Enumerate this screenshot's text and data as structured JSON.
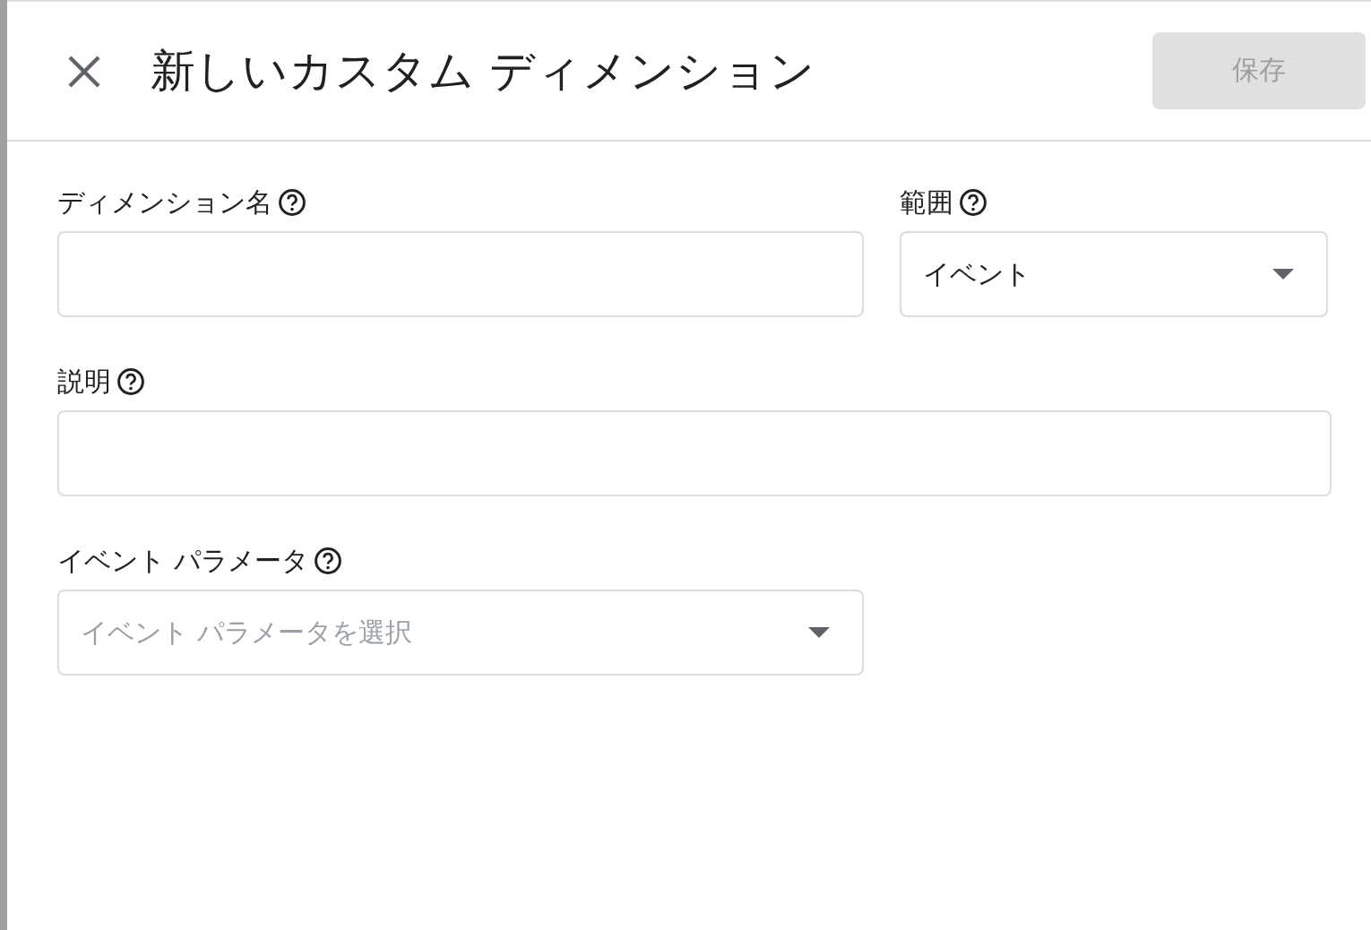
{
  "header": {
    "title": "新しいカスタム ディメンション",
    "save_button": {
      "label": "保存",
      "disabled": true
    }
  },
  "rows": [
    [
      {
        "kind": "text",
        "label": "ディメンション名"
      },
      {
        "kind": "select",
        "label": "範囲",
        "value": "イベント"
      }
    ],
    [
      {
        "kind": "text",
        "label": "説明"
      }
    ],
    [
      {
        "kind": "select",
        "label": "イベント パラメータ",
        "placeholder": "イベント パラメータを選択"
      }
    ]
  ]
}
